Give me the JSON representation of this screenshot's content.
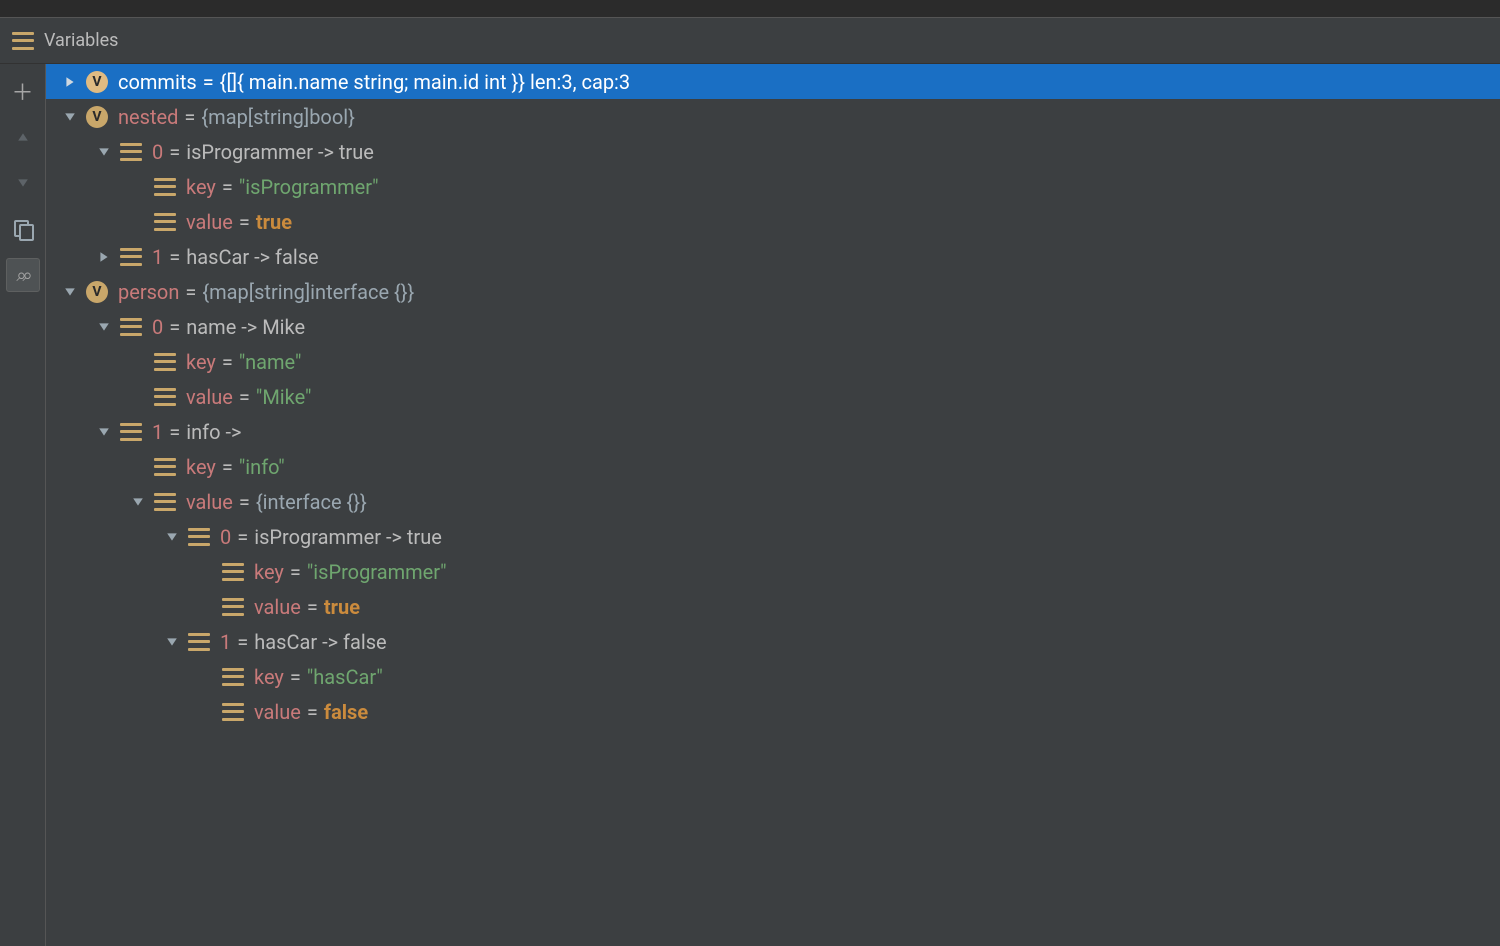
{
  "header": {
    "title": "Variables"
  },
  "icons": {
    "v_label": "V"
  },
  "rows": [
    {
      "id": "commits",
      "indent": 0,
      "arrow": "right",
      "icon": "v",
      "selected": true,
      "name": "commits",
      "name_color": "white",
      "value_text": "{[]{ main.name string; main.id int }} len:3, cap:3",
      "value_kind": "text"
    },
    {
      "id": "nested",
      "indent": 0,
      "arrow": "down",
      "icon": "v",
      "name": "nested",
      "name_color": "red",
      "value_text": "{map[string]bool}",
      "value_kind": "type"
    },
    {
      "id": "nested-0",
      "indent": 1,
      "arrow": "down",
      "icon": "obj",
      "name": "0",
      "name_color": "red",
      "value_text": "isProgrammer -> true",
      "value_kind": "text"
    },
    {
      "id": "nested-0-key",
      "indent": 2,
      "arrow": "none",
      "icon": "obj",
      "name": "key",
      "name_color": "red",
      "value_text": "\"isProgrammer\"",
      "value_kind": "string"
    },
    {
      "id": "nested-0-value",
      "indent": 2,
      "arrow": "none",
      "icon": "obj",
      "name": "value",
      "name_color": "red",
      "value_text": "true",
      "value_kind": "bool"
    },
    {
      "id": "nested-1",
      "indent": 1,
      "arrow": "right",
      "icon": "obj",
      "name": "1",
      "name_color": "red",
      "value_text": "hasCar -> false",
      "value_kind": "text"
    },
    {
      "id": "person",
      "indent": 0,
      "arrow": "down",
      "icon": "v",
      "name": "person",
      "name_color": "red",
      "value_text": "{map[string]interface {}}",
      "value_kind": "type"
    },
    {
      "id": "person-0",
      "indent": 1,
      "arrow": "down",
      "icon": "obj",
      "name": "0",
      "name_color": "red",
      "value_text": "name -> Mike",
      "value_kind": "text"
    },
    {
      "id": "person-0-key",
      "indent": 2,
      "arrow": "none",
      "icon": "obj",
      "name": "key",
      "name_color": "red",
      "value_text": "\"name\"",
      "value_kind": "string"
    },
    {
      "id": "person-0-value",
      "indent": 2,
      "arrow": "none",
      "icon": "obj",
      "name": "value",
      "name_color": "red",
      "value_text": "\"Mike\"",
      "value_kind": "string"
    },
    {
      "id": "person-1",
      "indent": 1,
      "arrow": "down",
      "icon": "obj",
      "name": "1",
      "name_color": "red",
      "value_text": "info ->",
      "value_kind": "text"
    },
    {
      "id": "person-1-key",
      "indent": 2,
      "arrow": "none",
      "icon": "obj",
      "name": "key",
      "name_color": "red",
      "value_text": "\"info\"",
      "value_kind": "string"
    },
    {
      "id": "person-1-value",
      "indent": 2,
      "arrow": "down",
      "icon": "obj",
      "name": "value",
      "name_color": "red",
      "value_text": "{interface {}}",
      "value_kind": "type"
    },
    {
      "id": "person-1-value-0",
      "indent": 3,
      "arrow": "down",
      "icon": "obj",
      "name": "0",
      "name_color": "red",
      "value_text": "isProgrammer -> true",
      "value_kind": "text"
    },
    {
      "id": "person-1-value-0-key",
      "indent": 4,
      "arrow": "none",
      "icon": "obj",
      "name": "key",
      "name_color": "red",
      "value_text": "\"isProgrammer\"",
      "value_kind": "string"
    },
    {
      "id": "person-1-value-0-value",
      "indent": 4,
      "arrow": "none",
      "icon": "obj",
      "name": "value",
      "name_color": "red",
      "value_text": "true",
      "value_kind": "bool"
    },
    {
      "id": "person-1-value-1",
      "indent": 3,
      "arrow": "down",
      "icon": "obj",
      "name": "1",
      "name_color": "red",
      "value_text": "hasCar -> false",
      "value_kind": "text"
    },
    {
      "id": "person-1-value-1-key",
      "indent": 4,
      "arrow": "none",
      "icon": "obj",
      "name": "key",
      "name_color": "red",
      "value_text": "\"hasCar\"",
      "value_kind": "string"
    },
    {
      "id": "person-1-value-1-value",
      "indent": 4,
      "arrow": "none",
      "icon": "obj",
      "name": "value",
      "name_color": "red",
      "value_text": "false",
      "value_kind": "bool"
    }
  ]
}
